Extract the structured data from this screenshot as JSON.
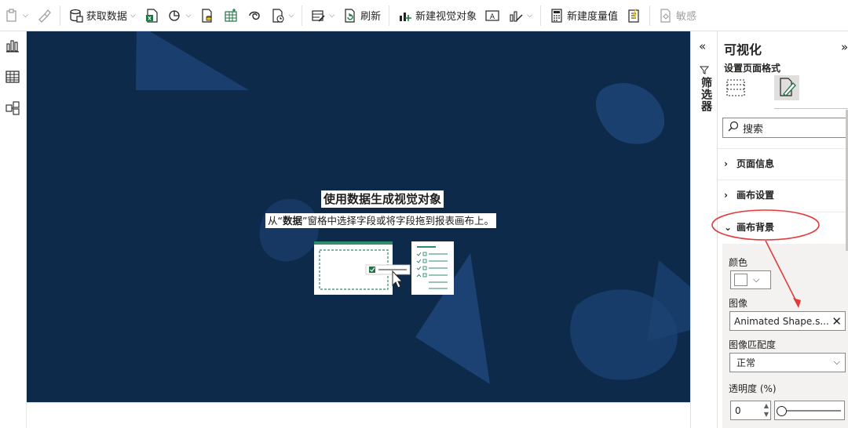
{
  "ribbon": {
    "get_data": "获取数据",
    "refresh": "刷新",
    "new_visual": "新建视觉对象",
    "new_measure": "新建度量值",
    "sensitivity": "敏感"
  },
  "canvas": {
    "placeholder_title": "使用数据生成视觉对象",
    "placeholder_sub_pre": "从“",
    "placeholder_sub_bold": "数据",
    "placeholder_sub_post": "”窗格中选择字段或将字段拖到报表画布上。"
  },
  "filters": {
    "label": "筛选器"
  },
  "viz": {
    "title": "可视化",
    "subtitle": "设置页面格式",
    "search_placeholder": "搜索",
    "sections": {
      "page_info": "页面信息",
      "canvas_settings": "画布设置",
      "canvas_background": "画布背景"
    },
    "color_label": "颜色",
    "image_label": "图像",
    "image_value": "Animated Shape.s...",
    "image_fit_label": "图像匹配度",
    "image_fit_value": "正常",
    "transparency_label": "透明度 (%)",
    "transparency_value": "0",
    "transparency_level": 0
  },
  "colors": {
    "canvas_bg": "#0e2a4a",
    "canvas_shape": "#1c4374",
    "accent_green": "#217346",
    "annotation_red": "#e23b3b"
  }
}
